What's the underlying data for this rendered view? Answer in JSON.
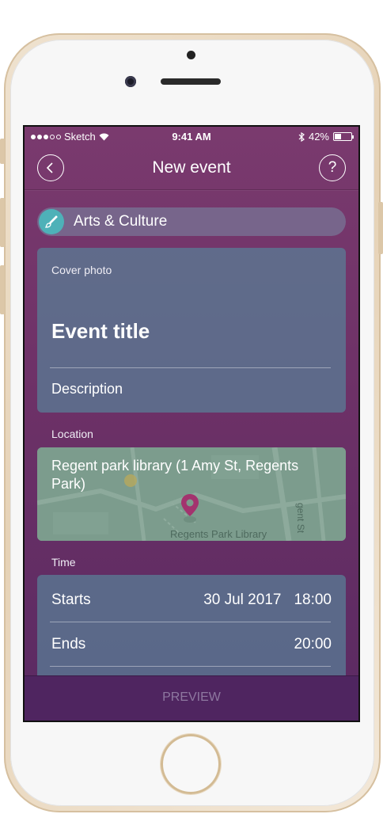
{
  "status_bar": {
    "carrier": "Sketch",
    "time": "9:41 AM",
    "battery_text": "42%",
    "battery_level": 0.42,
    "signal_bars": 3,
    "icons": [
      "wifi-icon",
      "bluetooth-icon",
      "battery-icon"
    ]
  },
  "nav": {
    "title": "New event",
    "back_icon": "chevron-left-icon",
    "help_label": "?"
  },
  "category": {
    "label": "Arts & Culture",
    "icon": "brush-icon",
    "icon_color": "#4eb1b8"
  },
  "cover": {
    "label": "Cover photo",
    "title_placeholder": "Event title",
    "description_placeholder": "Description"
  },
  "location": {
    "section_label": "Location",
    "address": "Regent park library (1 Amy St, Regents Park)",
    "map_poi": "Regents Park Library",
    "map_street": "gent St",
    "pin_color": "#a3336e"
  },
  "time": {
    "section_label": "Time",
    "starts_label": "Starts",
    "starts_date": "30 Jul 2017",
    "starts_time": "18:00",
    "ends_label": "Ends",
    "ends_time": "20:00"
  },
  "footer": {
    "preview_label": "PREVIEW"
  },
  "colors": {
    "screen_top": "#7a3a6e",
    "screen_bottom": "#5a2a62",
    "card": "#5a7d96",
    "bottom_bar": "#4f2560"
  }
}
